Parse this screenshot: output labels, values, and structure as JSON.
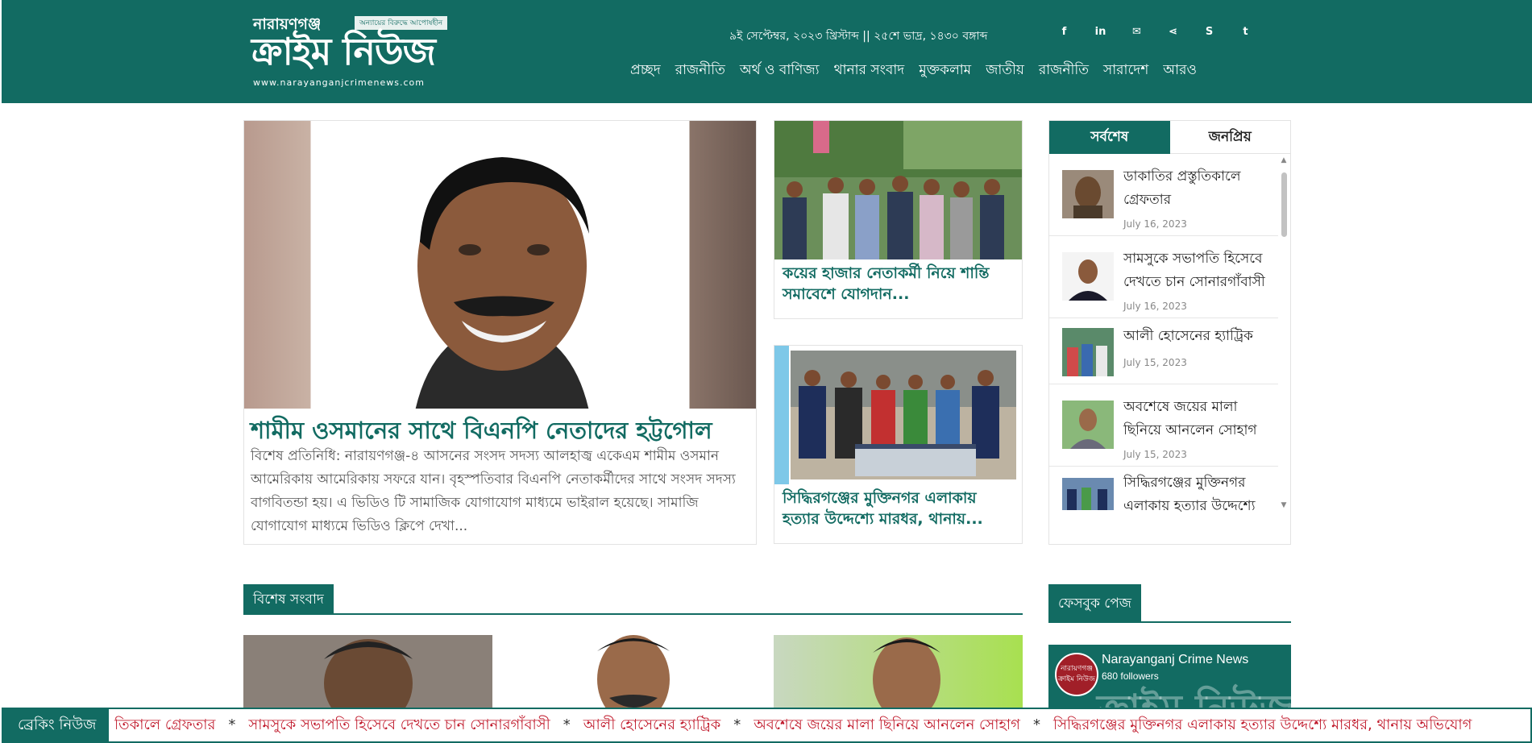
{
  "header": {
    "logo_location": "নারায়ণগঞ্জ",
    "logo_tagline": "অন্যায়ের বিরুদ্ধে আপোষহীন",
    "logo_brand": "ক্রাইম নিউজ",
    "logo_url": "www.narayanganjcrimenews.com",
    "date": "৯ই সেপ্টেম্বর, ২০২৩ খ্রিস্টাব্দ || ২৫শে ভাদ্র, ১৪৩০ বঙ্গাব্দ",
    "socials": [
      {
        "icon": "facebook-icon",
        "glyph": "f"
      },
      {
        "icon": "linkedin-icon",
        "glyph": "in"
      },
      {
        "icon": "email-icon",
        "glyph": "✉"
      },
      {
        "icon": "share-icon",
        "glyph": "⋖"
      },
      {
        "icon": "skype-icon",
        "glyph": "S"
      },
      {
        "icon": "twitter-icon",
        "glyph": "t"
      }
    ],
    "nav": [
      "প্রচ্ছদ",
      "রাজনীতি",
      "অর্থ ও বাণিজ্য",
      "থানার সংবাদ",
      "মুক্তকলাম",
      "জাতীয়",
      "রাজনীতি",
      "সারাদেশ",
      "আরও"
    ]
  },
  "lead": {
    "title": "শামীম ওসমানের সাথে বিএনপি নেতাদের হট্টগোল",
    "excerpt": "বিশেষ প্রতিনিধি: নারায়ণগঞ্জ-৪ আসনের সংসদ সদস্য আলহাজ্ব একেএম শামীম ওসমান আমেরিকায় আমেরিকায় সফরে যান। বৃহস্পতিবার বিএনপি নেতাকর্মীদের সাথে সংসদ সদস্য বাগবিতন্ডা হয়। এ ভিডিও টি সামাজিক যোগাযোগ মাধ্যমে ভাইরাল হয়েছে। সামাজি যোগাযোগ মাধ্যমে ভিডিও ক্লিপে দেখা..."
  },
  "side_stories": [
    {
      "title": "কয়ের হাজার নেতাকর্মী নিয়ে শান্তি সমাবেশে যোগদান..."
    },
    {
      "title": "সিদ্ধিরগঞ্জের মুক্তিনগর এলাকায় হত্যার উদ্দেশ্যে মারধর, থানায়..."
    }
  ],
  "tabs": {
    "active": "সর্বশেষ",
    "inactive": "জনপ্রিয়",
    "items": [
      {
        "title": "ডাকাতির প্রস্তুতিকালে গ্রেফতার",
        "date": "July 16, 2023"
      },
      {
        "title": "সামসুকে সভাপতি হিসেবে দেখতে চান সোনারগাঁবাসী",
        "date": "July 16, 2023"
      },
      {
        "title": "আলী হোসেনের হ্যাট্রিক",
        "date": "July 15, 2023"
      },
      {
        "title": "অবশেষে জয়ের মালা ছিনিয়ে আনলেন সোহাগ",
        "date": "July 15, 2023"
      },
      {
        "title": "সিদ্ধিরগঞ্জের মুক্তিনগর এলাকায় হত্যার উদ্দেশ্যে",
        "date": ""
      }
    ]
  },
  "sections": {
    "special": "বিশেষ সংবাদ",
    "facebook": "ফেসবুক পেজ"
  },
  "facebook": {
    "name": "Narayanganj Crime News",
    "followers": "680 followers",
    "avatar_text": "নারায়ণগঞ্জ ক্রাইম নিউজ",
    "bg_text": "ক্রাইম নিউজ"
  },
  "ticker": {
    "label": "ব্রেকিং নিউজ",
    "items": [
      "তিকালে গ্রেফতার",
      "সামসুকে সভাপতি হিসেবে দেখতে চান সোনারগাঁবাসী",
      "আলী হোসেনের হ্যাট্রিক",
      "অবশেষে জয়ের মালা ছিনিয়ে আনলেন সোহাগ",
      "সিদ্ধিরগঞ্জের মুক্তিনগর এলাকায় হত্যার উদ্দেশ্যে মারধর, থানায় অভিযোগ"
    ],
    "separator": "*"
  },
  "colors": {
    "brand": "#126b62",
    "ticker_text": "#c0182a"
  }
}
